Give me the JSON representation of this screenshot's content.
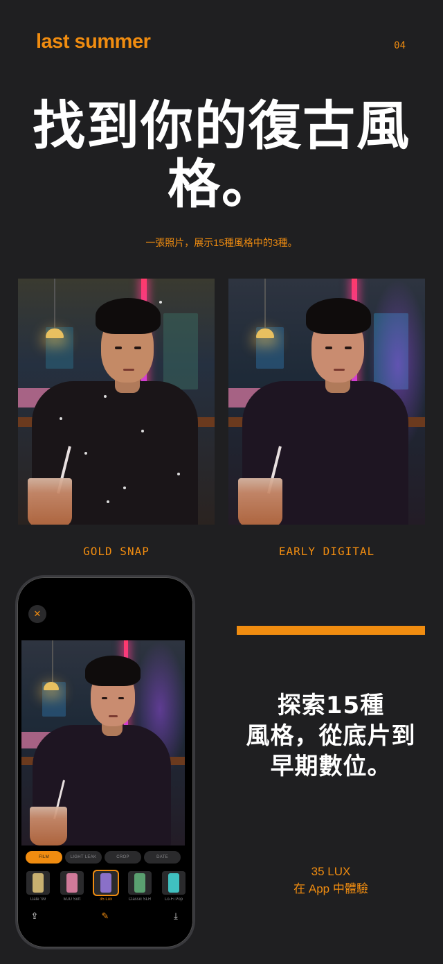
{
  "header": {
    "brand": "last summer",
    "page_number": "04"
  },
  "hero": {
    "headline_line1": "找到你的復古風",
    "headline_line2": "格。",
    "subtitle": "一張照片，展示15種風格中的3種。"
  },
  "comparison": {
    "left_caption": "GOLD SNAP",
    "right_caption": "EARLY DIGITAL"
  },
  "phone": {
    "close_icon": "close-icon",
    "tabs": [
      "FILM",
      "LIGHT LEAK",
      "CROP",
      "DATE"
    ],
    "active_tab": "FILM",
    "filters": [
      {
        "label": "Date '99",
        "color": "#c8b070"
      },
      {
        "label": "MJU Soft",
        "color": "#d07a9a"
      },
      {
        "label": "35 Lux",
        "color": "#8a70c8"
      },
      {
        "label": "Classic SLR",
        "color": "#5aa070"
      },
      {
        "label": "Lo-Fi Pop",
        "color": "#40c0c0"
      }
    ],
    "selected_filter": "35 Lux",
    "bottom_icons": [
      "share-icon",
      "edit-icon",
      "download-icon"
    ]
  },
  "feature": {
    "line1": "探索15種",
    "line2": "風格，從底片到",
    "line3": "早期數位。"
  },
  "cta": {
    "app_name": "35 LUX",
    "tagline": "在 App 中體驗"
  },
  "colors": {
    "accent": "#f08c10",
    "background": "#1f1f21"
  }
}
